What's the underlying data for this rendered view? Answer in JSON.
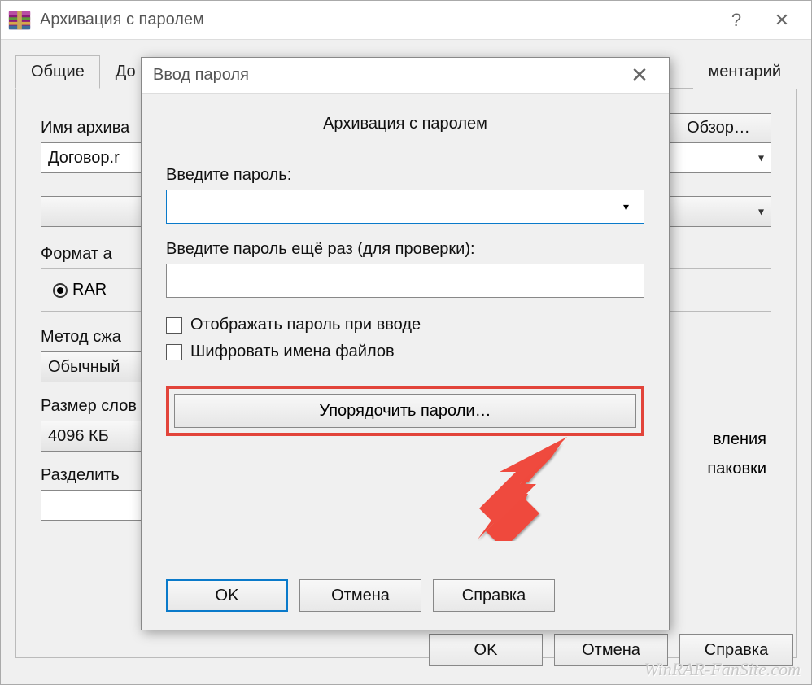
{
  "window": {
    "title": "Архивация с паролем",
    "help": "?",
    "close": "✕"
  },
  "tabs": [
    "Общие",
    "Дополнительно",
    "Комментарий"
  ],
  "tabs_partial": {
    "t1": "До",
    "t2": "ментарий"
  },
  "main": {
    "archive_name_label": "Имя архива",
    "archive_name_value": "Договор.r",
    "browse": "Обзор…",
    "format_label": "Формат а",
    "formats": {
      "rar": "RAR"
    },
    "method_label": "Метод сжа",
    "method_value": "Обычный",
    "dict_label": "Размер слов",
    "dict_value": "4096 КБ",
    "split_label": "Разделить",
    "opts_right": {
      "a": "вления",
      "b": "паковки"
    },
    "ok": "OK",
    "cancel": "Отмена",
    "help": "Справка"
  },
  "modal": {
    "title": "Ввод пароля",
    "heading": "Архивация с паролем",
    "pw_label": "Введите пароль:",
    "pw2_label": "Введите пароль ещё раз (для проверки):",
    "show_pw": "Отображать пароль при вводе",
    "encrypt": "Шифровать имена файлов",
    "manage": "Упорядочить пароли…",
    "ok": "OK",
    "cancel": "Отмена",
    "help": "Справка"
  },
  "watermark": "WinRAR-FanSite.com"
}
